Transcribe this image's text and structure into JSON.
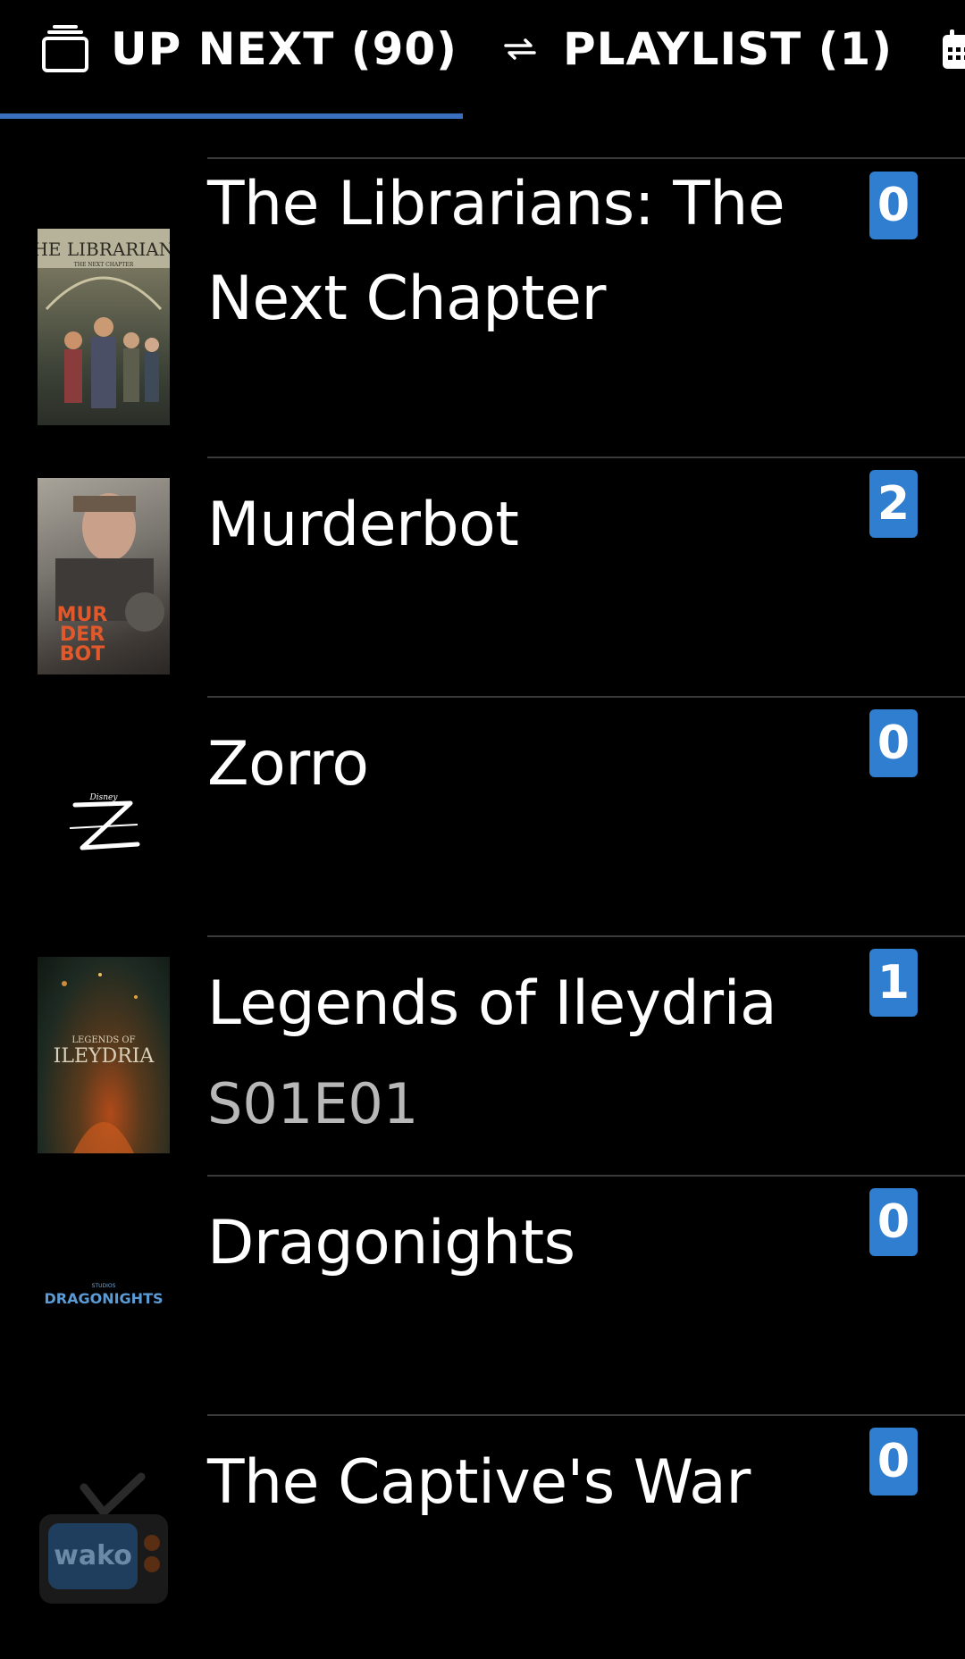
{
  "tabs": [
    {
      "label": "UP NEXT (90)",
      "icon": "stacked-cards-icon",
      "selected": true
    },
    {
      "label": "PLAYLIST (1)",
      "icon": "repeat-icon",
      "selected": false
    },
    {
      "label": "",
      "icon": "calendar-icon",
      "selected": false
    }
  ],
  "accent_color": "#3a6fc0",
  "badge_color": "#2f7ed0",
  "shows": [
    {
      "title": "The Librarians: The Next Chapter",
      "subtitle": "",
      "count": "0",
      "poster_text": "THE LIBRARIANS",
      "poster_subtext": "THE NEXT CHAPTER"
    },
    {
      "title": "Murderbot",
      "subtitle": "",
      "count": "2",
      "poster_text": "MUR DER BOT"
    },
    {
      "title": "Zorro",
      "subtitle": "",
      "count": "0",
      "poster_text": "Z",
      "poster_subtext": "Disney"
    },
    {
      "title": "Legends of Ileydria",
      "subtitle": "S01E01",
      "count": "1",
      "poster_text": "LEGENDS OF ILEYDRIA"
    },
    {
      "title": "Dragonights",
      "subtitle": "",
      "count": "0",
      "poster_text": "DRAGONIGHTS"
    },
    {
      "title": "The Captive's War",
      "subtitle": "",
      "count": "0",
      "poster_text": "wako"
    }
  ]
}
